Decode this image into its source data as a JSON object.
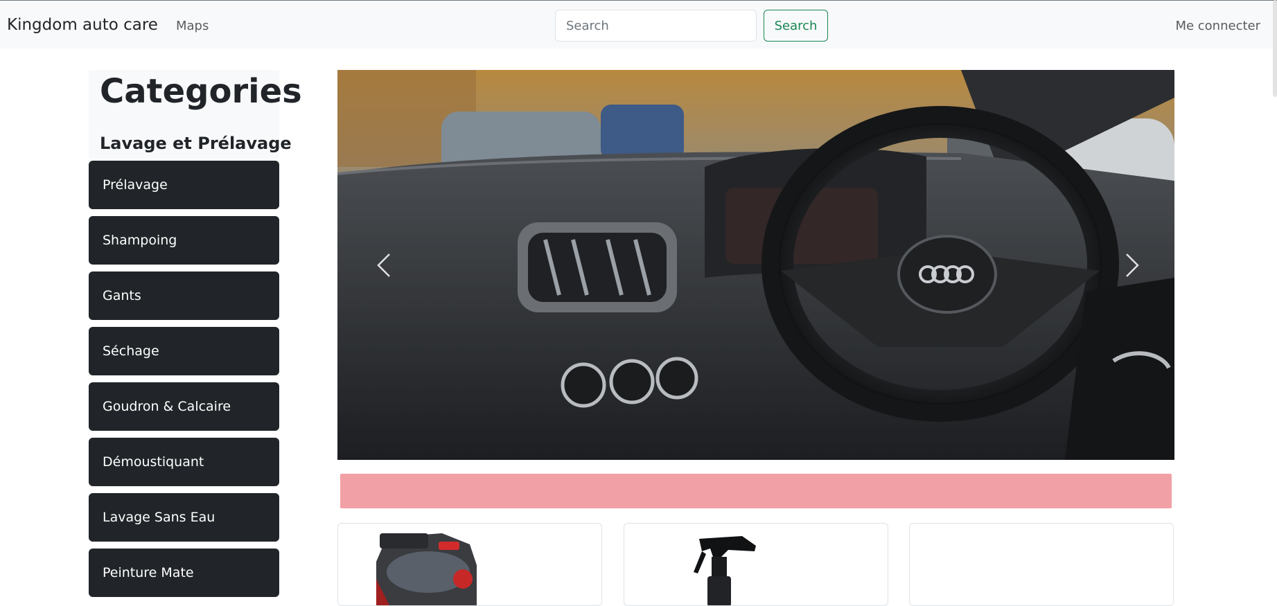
{
  "navbar": {
    "brand": "Kingdom auto care",
    "maps_link": "Maps",
    "search_placeholder": "Search",
    "search_button": "Search",
    "login_link": "Me connecter"
  },
  "sidebar": {
    "title": "Categories",
    "subtitle": "Lavage et Prélavage",
    "items": [
      {
        "label": "Prélavage"
      },
      {
        "label": "Shampoing"
      },
      {
        "label": "Gants"
      },
      {
        "label": "Séchage"
      },
      {
        "label": "Goudron & Calcaire"
      },
      {
        "label": "Démoustiquant"
      },
      {
        "label": "Lavage Sans Eau"
      },
      {
        "label": "Peinture Mate"
      }
    ]
  },
  "carousel": {
    "image": "car-interior-dashboard-steering-wheel",
    "prev_icon": "chevron-left-icon",
    "next_icon": "chevron-right-icon"
  },
  "alert": {
    "color": "#f1a0a6"
  },
  "products": [
    {
      "image": "vacuum-cleaner-product-image"
    },
    {
      "image": "spray-bottle-product-image"
    },
    {
      "image": "empty-product-image"
    }
  ],
  "colors": {
    "sidebar_button": "#212529",
    "search_button": "#198754",
    "navbar_bg": "#f8f9fa"
  }
}
